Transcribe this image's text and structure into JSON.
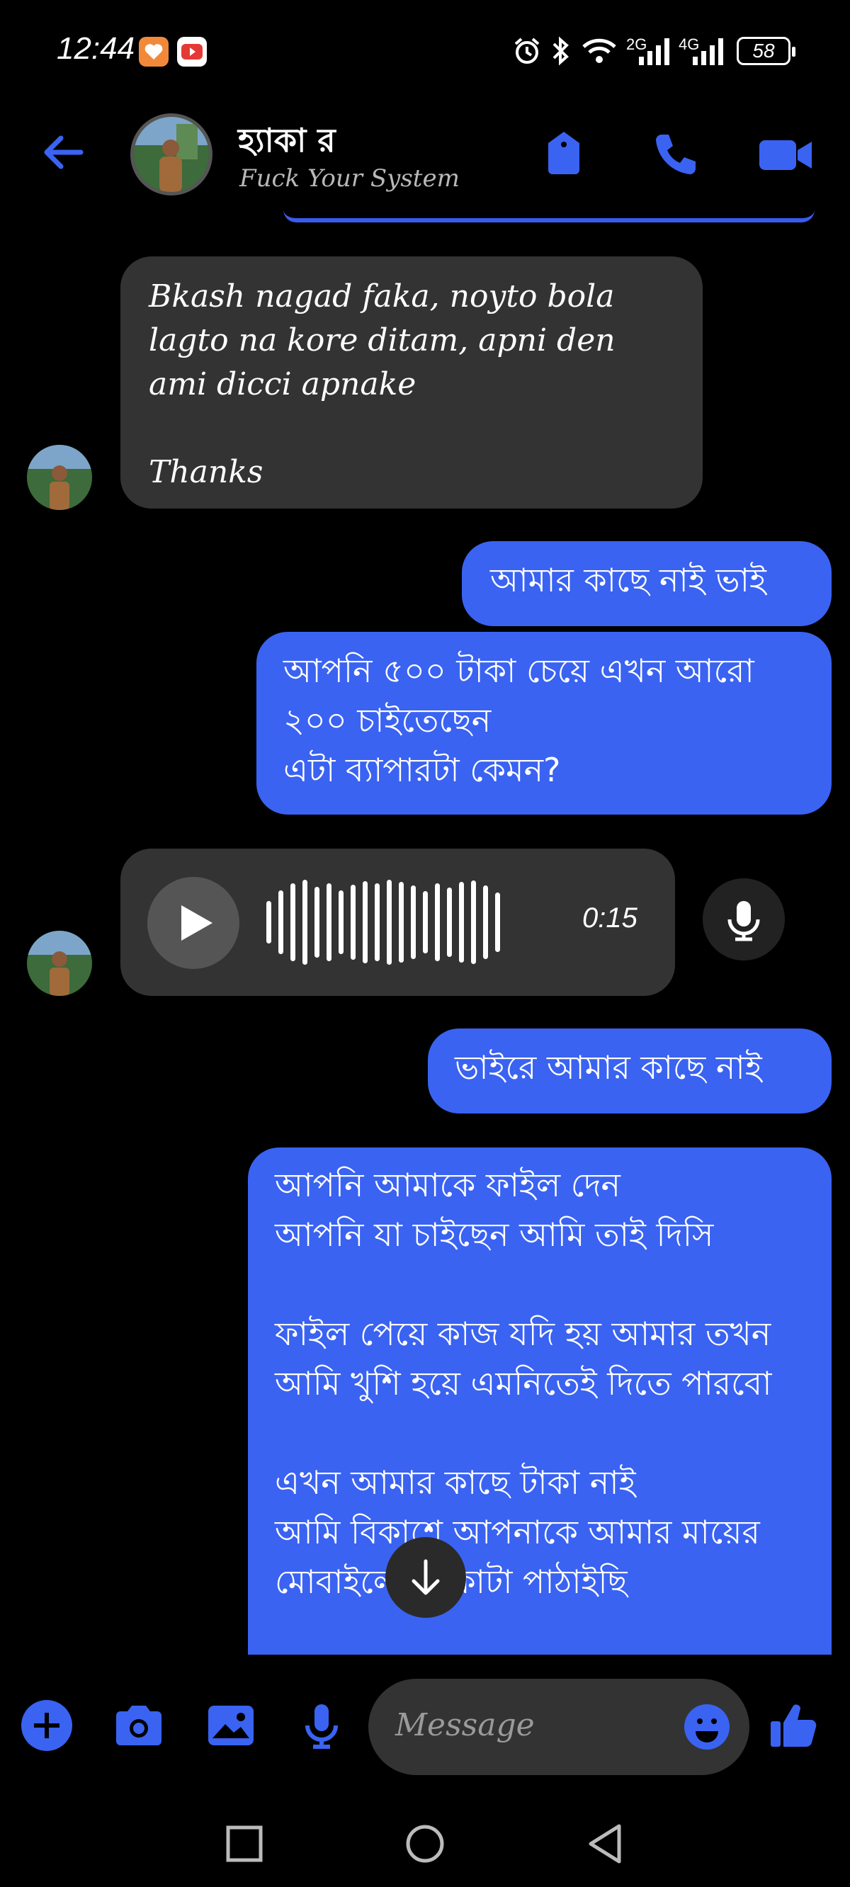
{
  "status_bar": {
    "time": "12:44",
    "network_1": "2G",
    "network_2": "4G",
    "battery": "58"
  },
  "header": {
    "contact_name": "হ্যাকা র",
    "contact_status": "Fuck Your System"
  },
  "messages": [
    {
      "direction": "incoming",
      "text": "Bkash nagad faka, noyto bola lagto na kore ditam, apni den ami dicci apnake\n\nThanks"
    },
    {
      "direction": "outgoing",
      "text": "আমার কাছে নাই ভাই"
    },
    {
      "direction": "outgoing",
      "text": "আপনি ৫০০ টাকা চেয়ে এখন আরো ২০০ চাইতেছেন\nএটা ব্যাপারটা কেমন?"
    },
    {
      "direction": "incoming",
      "type": "voice",
      "duration": "0:15"
    },
    {
      "direction": "outgoing",
      "text": "ভাইরে আমার কাছে নাই"
    },
    {
      "direction": "outgoing",
      "text": "আপনি আমাকে ফাইল দেন\nআপনি যা চাইছেন আমি তাই দিসি\n\nফাইল পেয়ে কাজ যদি হয় আমার তখন আমি খুশি হয়ে এমনিতেই দিতে পারবো\n\nএখন আমার কাছে টাকা নাই\nআমি বিকাশে আপনাকে আমার মায়ের মোবাইলের টাকাটা পাঠাইছি"
    }
  ],
  "composer": {
    "placeholder": "Message"
  },
  "colors": {
    "accent": "#3a63f2",
    "incoming_bubble": "#333333",
    "background": "#000000"
  }
}
